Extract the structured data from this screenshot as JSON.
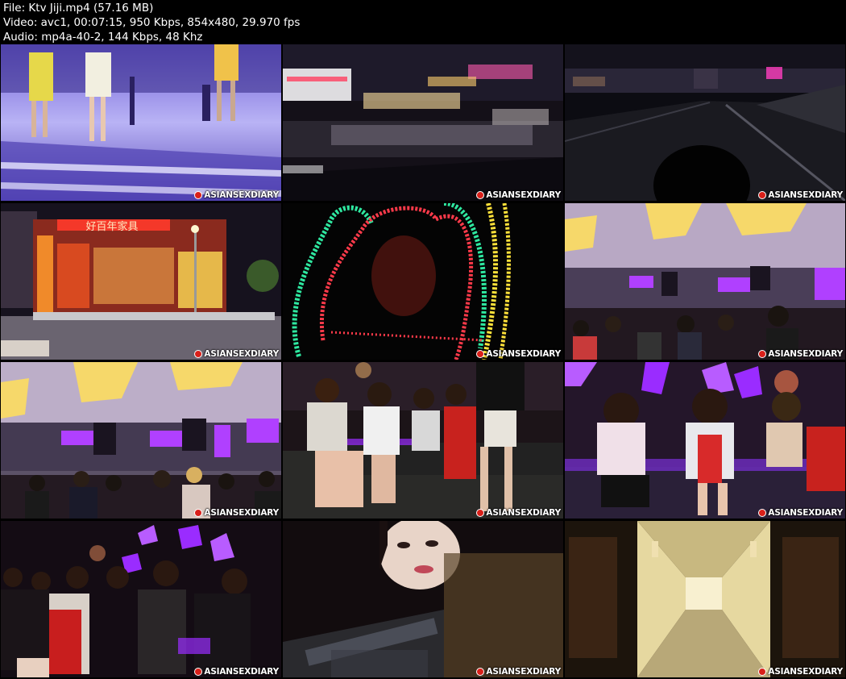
{
  "header": {
    "file_line": "File: Ktv Jiji.mp4 (57.16 MB)",
    "video_line": "Video: avc1, 00:07:15, 950 Kbps, 854x480, 29.970 fps",
    "audio_line": "Audio: mp4a-40-2, 144 Kbps, 48 Khz"
  },
  "watermark": "ASIANSEXDIARY",
  "sign_text": "好百年家具",
  "colors": {
    "background": "#000000",
    "text": "#ffffff",
    "purple_light": "#9a2cff",
    "neon_green": "#2ee8a0",
    "neon_red": "#ff3a4a",
    "neon_yellow": "#ffe23a"
  }
}
